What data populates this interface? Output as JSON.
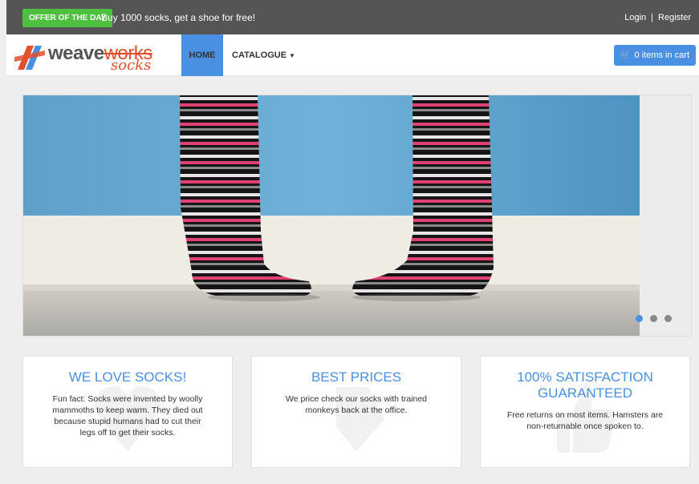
{
  "topbar": {
    "offer_label": "OFFER OF THE DAY",
    "offer_text": "Buy 1000 socks, get a shoe for free!",
    "login": "Login",
    "separator": "|",
    "register": "Register"
  },
  "navbar": {
    "logo_word1": "weave",
    "logo_word2": "works",
    "logo_word3": "socks",
    "home": "HOME",
    "catalogue": "CATALOGUE",
    "cart": "0 items in cart",
    "cart_icon": "shopping-cart-icon"
  },
  "carousel": {
    "slides": 3,
    "active_slide": 1
  },
  "features": [
    {
      "title": "WE LOVE SOCKS!",
      "text": "Fun fact: Socks were invented by woolly mammoths to keep warm. They died out because stupid humans had to cut their legs off to get their socks."
    },
    {
      "title": "BEST PRICES",
      "text": "We price check our socks with trained monkeys back at the office."
    },
    {
      "title": "100% SATISFACTION GUARANTEED",
      "text": "Free returns on most items. Hamsters are non-returnable once spoken to."
    }
  ],
  "colors": {
    "topbar_bg": "#555555",
    "offer_green": "#4fbf40",
    "accent_blue": "#4a90e2",
    "logo_orange": "#e0502c"
  }
}
